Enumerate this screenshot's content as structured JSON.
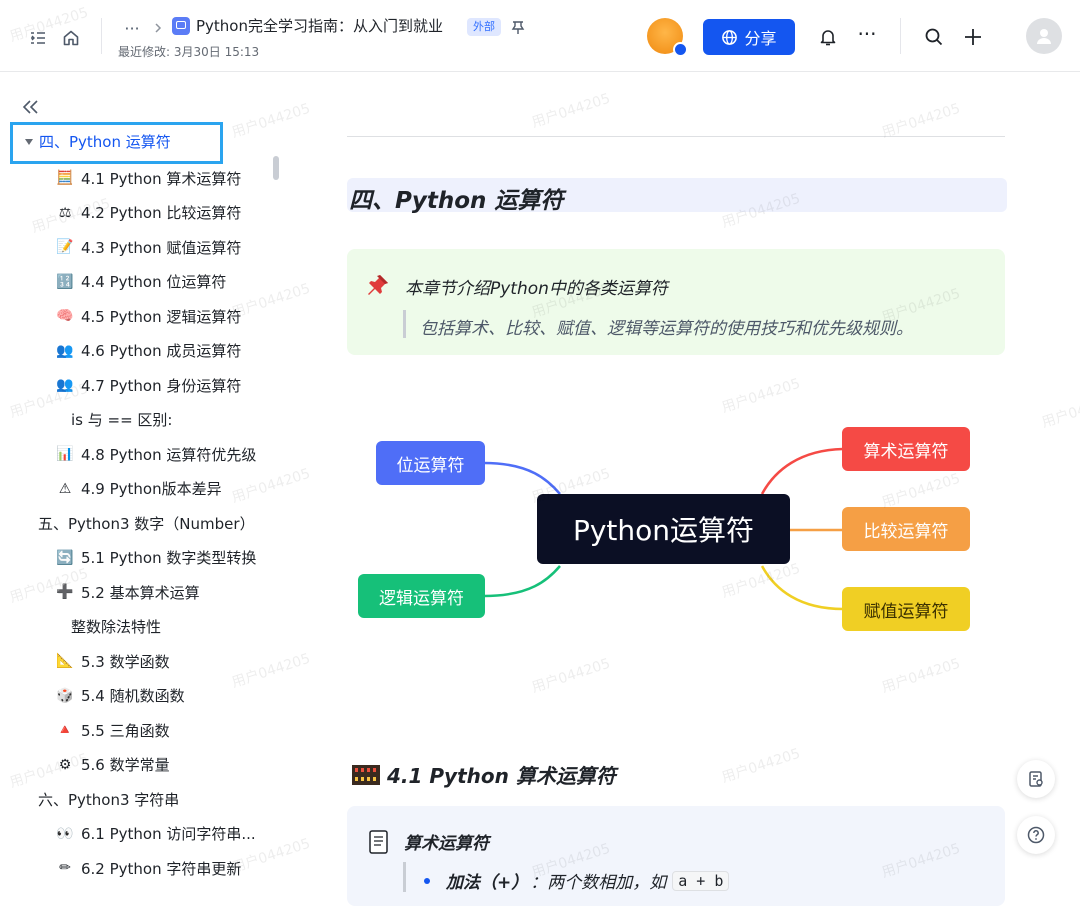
{
  "header": {
    "title": "Python完全学习指南：从入门到就业",
    "badge": "外部",
    "meta": "最近修改: 3月30日 15:13",
    "more_dots": "···",
    "share_label": "分享"
  },
  "sidebar": {
    "active_item": "四、Python 运算符",
    "items": [
      {
        "label": "4.1 Python 算术运算符",
        "icon": "abacus-icon",
        "glyph": "🧮",
        "indent": 2
      },
      {
        "label": "4.2 Python 比较运算符",
        "icon": "scales-icon",
        "glyph": "⚖",
        "indent": 2
      },
      {
        "label": "4.3 Python 赋值运算符",
        "icon": "memo-icon",
        "glyph": "📝",
        "indent": 2
      },
      {
        "label": "4.4 Python 位运算符",
        "icon": "numbers-icon",
        "glyph": "🔢",
        "indent": 2
      },
      {
        "label": "4.5 Python 逻辑运算符",
        "icon": "brain-icon",
        "glyph": "🧠",
        "indent": 2
      },
      {
        "label": "4.6 Python 成员运算符",
        "icon": "people-icon",
        "glyph": "👥",
        "indent": 2
      },
      {
        "label": "4.7 Python 身份运算符",
        "icon": "people-icon",
        "glyph": "👥",
        "indent": 2
      },
      {
        "label": "is 与 == 区别:",
        "icon": "",
        "glyph": "",
        "indent": 3
      },
      {
        "label": "4.8 Python 运算符优先级",
        "icon": "bar-chart-icon",
        "glyph": "📊",
        "indent": 2
      },
      {
        "label": "4.9 Python版本差异",
        "icon": "warning-icon",
        "glyph": "⚠",
        "indent": 2
      },
      {
        "label": "五、Python3 数字（Number）",
        "icon": "",
        "glyph": "",
        "indent": 1
      },
      {
        "label": "5.1 Python 数字类型转换",
        "icon": "refresh-icon",
        "glyph": "🔄",
        "indent": 2
      },
      {
        "label": "5.2 基本算术运算",
        "icon": "plus-icon",
        "glyph": "➕",
        "indent": 2
      },
      {
        "label": "整数除法特性",
        "icon": "",
        "glyph": "",
        "indent": 3
      },
      {
        "label": "5.3 数学函数",
        "icon": "triangle-ruler-icon",
        "glyph": "📐",
        "indent": 2
      },
      {
        "label": "5.4 随机数函数",
        "icon": "dice-icon",
        "glyph": "🎲",
        "indent": 2
      },
      {
        "label": "5.5 三角函数",
        "icon": "red-triangle-icon",
        "glyph": "🔺",
        "indent": 2
      },
      {
        "label": "5.6 数学常量",
        "icon": "gear-icon",
        "glyph": "⚙",
        "indent": 2
      },
      {
        "label": "六、Python3 字符串",
        "icon": "",
        "glyph": "",
        "indent": 1
      },
      {
        "label": "6.1 Python 访问字符串...",
        "icon": "eyes-icon",
        "glyph": "👀",
        "indent": 2
      },
      {
        "label": "6.2 Python 字符串更新",
        "icon": "pencil-icon",
        "glyph": "✏",
        "indent": 2
      }
    ]
  },
  "main": {
    "heading": "四、Python 运算符",
    "callout_title": "本章节介绍Python中的各类运算符",
    "callout_text": "包括算术、比较、赋值、逻辑等运算符的使用技巧和优先级规则。",
    "mindmap": {
      "center": "Python运算符",
      "nodes": [
        {
          "label": "位运算符",
          "color": "#4f6ef7"
        },
        {
          "label": "逻辑运算符",
          "color": "#16c079"
        },
        {
          "label": "算术运算符",
          "color": "#f54a45"
        },
        {
          "label": "比较运算符",
          "color": "#f59f45"
        },
        {
          "label": "赋值运算符",
          "color": "#f0cf24"
        }
      ]
    },
    "section_heading": "4.1 Python 算术运算符",
    "card_title": "算术运算符",
    "bullet_bold": "加法（+）",
    "bullet_text": "：两个数相加，如",
    "bullet_code": "a + b"
  },
  "watermark": "用户044205",
  "colors": {
    "accent": "#1456f0",
    "active_outline": "#2aa4ef"
  }
}
